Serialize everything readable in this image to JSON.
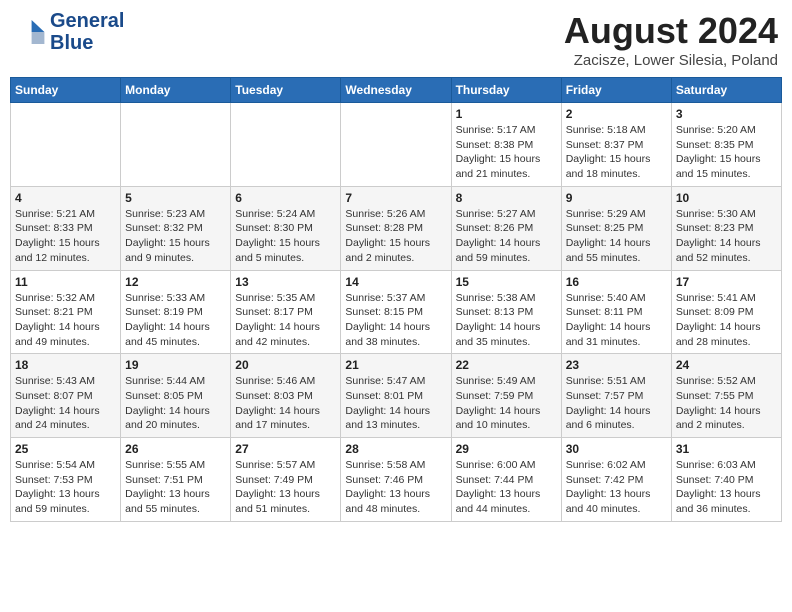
{
  "header": {
    "logo_line1": "General",
    "logo_line2": "Blue",
    "title": "August 2024",
    "subtitle": "Zacisze, Lower Silesia, Poland"
  },
  "weekdays": [
    "Sunday",
    "Monday",
    "Tuesday",
    "Wednesday",
    "Thursday",
    "Friday",
    "Saturday"
  ],
  "weeks": [
    [
      {
        "day": "",
        "info": ""
      },
      {
        "day": "",
        "info": ""
      },
      {
        "day": "",
        "info": ""
      },
      {
        "day": "",
        "info": ""
      },
      {
        "day": "1",
        "info": "Sunrise: 5:17 AM\nSunset: 8:38 PM\nDaylight: 15 hours\nand 21 minutes."
      },
      {
        "day": "2",
        "info": "Sunrise: 5:18 AM\nSunset: 8:37 PM\nDaylight: 15 hours\nand 18 minutes."
      },
      {
        "day": "3",
        "info": "Sunrise: 5:20 AM\nSunset: 8:35 PM\nDaylight: 15 hours\nand 15 minutes."
      }
    ],
    [
      {
        "day": "4",
        "info": "Sunrise: 5:21 AM\nSunset: 8:33 PM\nDaylight: 15 hours\nand 12 minutes."
      },
      {
        "day": "5",
        "info": "Sunrise: 5:23 AM\nSunset: 8:32 PM\nDaylight: 15 hours\nand 9 minutes."
      },
      {
        "day": "6",
        "info": "Sunrise: 5:24 AM\nSunset: 8:30 PM\nDaylight: 15 hours\nand 5 minutes."
      },
      {
        "day": "7",
        "info": "Sunrise: 5:26 AM\nSunset: 8:28 PM\nDaylight: 15 hours\nand 2 minutes."
      },
      {
        "day": "8",
        "info": "Sunrise: 5:27 AM\nSunset: 8:26 PM\nDaylight: 14 hours\nand 59 minutes."
      },
      {
        "day": "9",
        "info": "Sunrise: 5:29 AM\nSunset: 8:25 PM\nDaylight: 14 hours\nand 55 minutes."
      },
      {
        "day": "10",
        "info": "Sunrise: 5:30 AM\nSunset: 8:23 PM\nDaylight: 14 hours\nand 52 minutes."
      }
    ],
    [
      {
        "day": "11",
        "info": "Sunrise: 5:32 AM\nSunset: 8:21 PM\nDaylight: 14 hours\nand 49 minutes."
      },
      {
        "day": "12",
        "info": "Sunrise: 5:33 AM\nSunset: 8:19 PM\nDaylight: 14 hours\nand 45 minutes."
      },
      {
        "day": "13",
        "info": "Sunrise: 5:35 AM\nSunset: 8:17 PM\nDaylight: 14 hours\nand 42 minutes."
      },
      {
        "day": "14",
        "info": "Sunrise: 5:37 AM\nSunset: 8:15 PM\nDaylight: 14 hours\nand 38 minutes."
      },
      {
        "day": "15",
        "info": "Sunrise: 5:38 AM\nSunset: 8:13 PM\nDaylight: 14 hours\nand 35 minutes."
      },
      {
        "day": "16",
        "info": "Sunrise: 5:40 AM\nSunset: 8:11 PM\nDaylight: 14 hours\nand 31 minutes."
      },
      {
        "day": "17",
        "info": "Sunrise: 5:41 AM\nSunset: 8:09 PM\nDaylight: 14 hours\nand 28 minutes."
      }
    ],
    [
      {
        "day": "18",
        "info": "Sunrise: 5:43 AM\nSunset: 8:07 PM\nDaylight: 14 hours\nand 24 minutes."
      },
      {
        "day": "19",
        "info": "Sunrise: 5:44 AM\nSunset: 8:05 PM\nDaylight: 14 hours\nand 20 minutes."
      },
      {
        "day": "20",
        "info": "Sunrise: 5:46 AM\nSunset: 8:03 PM\nDaylight: 14 hours\nand 17 minutes."
      },
      {
        "day": "21",
        "info": "Sunrise: 5:47 AM\nSunset: 8:01 PM\nDaylight: 14 hours\nand 13 minutes."
      },
      {
        "day": "22",
        "info": "Sunrise: 5:49 AM\nSunset: 7:59 PM\nDaylight: 14 hours\nand 10 minutes."
      },
      {
        "day": "23",
        "info": "Sunrise: 5:51 AM\nSunset: 7:57 PM\nDaylight: 14 hours\nand 6 minutes."
      },
      {
        "day": "24",
        "info": "Sunrise: 5:52 AM\nSunset: 7:55 PM\nDaylight: 14 hours\nand 2 minutes."
      }
    ],
    [
      {
        "day": "25",
        "info": "Sunrise: 5:54 AM\nSunset: 7:53 PM\nDaylight: 13 hours\nand 59 minutes."
      },
      {
        "day": "26",
        "info": "Sunrise: 5:55 AM\nSunset: 7:51 PM\nDaylight: 13 hours\nand 55 minutes."
      },
      {
        "day": "27",
        "info": "Sunrise: 5:57 AM\nSunset: 7:49 PM\nDaylight: 13 hours\nand 51 minutes."
      },
      {
        "day": "28",
        "info": "Sunrise: 5:58 AM\nSunset: 7:46 PM\nDaylight: 13 hours\nand 48 minutes."
      },
      {
        "day": "29",
        "info": "Sunrise: 6:00 AM\nSunset: 7:44 PM\nDaylight: 13 hours\nand 44 minutes."
      },
      {
        "day": "30",
        "info": "Sunrise: 6:02 AM\nSunset: 7:42 PM\nDaylight: 13 hours\nand 40 minutes."
      },
      {
        "day": "31",
        "info": "Sunrise: 6:03 AM\nSunset: 7:40 PM\nDaylight: 13 hours\nand 36 minutes."
      }
    ]
  ]
}
